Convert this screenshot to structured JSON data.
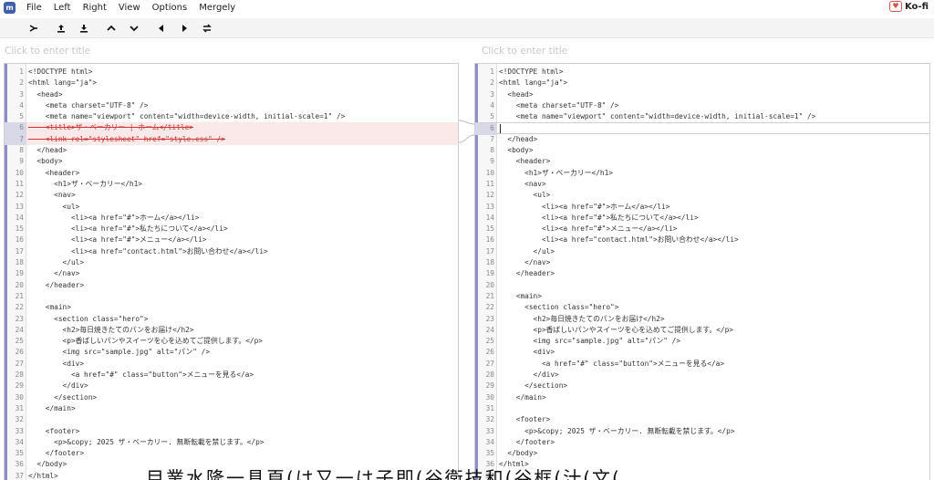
{
  "menubar": {
    "items": [
      "File",
      "Left",
      "Right",
      "View",
      "Options",
      "Mergely"
    ],
    "kofi_label": "Ko-fi"
  },
  "titles": {
    "left_placeholder": "Click to enter title",
    "right_placeholder": "Click to enter title"
  },
  "left_lines": [
    {
      "n": "1",
      "t": "<!DOCTYPE html>"
    },
    {
      "n": "2",
      "t": "<html lang=\"ja\">"
    },
    {
      "n": "3",
      "t": "  <head>"
    },
    {
      "n": "4",
      "t": "    <meta charset=\"UTF-8\" />"
    },
    {
      "n": "5",
      "t": "    <meta name=\"viewport\" content=\"width=device-width, initial-scale=1\" />"
    },
    {
      "n": "6",
      "t": "    <title>ザ・ベーカリー | ホーム</title>",
      "deleted": true
    },
    {
      "n": "7",
      "t": "    <link rel=\"stylesheet\" href=\"style.css\" />",
      "deleted": true
    },
    {
      "n": "8",
      "t": "  </head>"
    },
    {
      "n": "9",
      "t": "  <body>"
    },
    {
      "n": "10",
      "t": "    <header>"
    },
    {
      "n": "11",
      "t": "      <h1>ザ・ベーカリー</h1>"
    },
    {
      "n": "12",
      "t": "      <nav>"
    },
    {
      "n": "13",
      "t": "        <ul>"
    },
    {
      "n": "14",
      "t": "          <li><a href=\"#\">ホーム</a></li>"
    },
    {
      "n": "15",
      "t": "          <li><a href=\"#\">私たちについて</a></li>"
    },
    {
      "n": "16",
      "t": "          <li><a href=\"#\">メニュー</a></li>"
    },
    {
      "n": "17",
      "t": "          <li><a href=\"contact.html\">お問い合わせ</a></li>"
    },
    {
      "n": "18",
      "t": "        </ul>"
    },
    {
      "n": "19",
      "t": "      </nav>"
    },
    {
      "n": "20",
      "t": "    </header>"
    },
    {
      "n": "21",
      "t": ""
    },
    {
      "n": "22",
      "t": "    <main>"
    },
    {
      "n": "23",
      "t": "      <section class=\"hero\">"
    },
    {
      "n": "24",
      "t": "        <h2>毎日焼きたてのパンをお届け</h2>"
    },
    {
      "n": "25",
      "t": "        <p>香ばしいパンやスイーツを心を込めてご提供します。</p>"
    },
    {
      "n": "26",
      "t": "        <img src=\"sample.jpg\" alt=\"パン\" />"
    },
    {
      "n": "27",
      "t": "        <div>"
    },
    {
      "n": "28",
      "t": "          <a href=\"#\" class=\"button\">メニューを見る</a>"
    },
    {
      "n": "29",
      "t": "        </div>"
    },
    {
      "n": "30",
      "t": "      </section>"
    },
    {
      "n": "31",
      "t": "    </main>"
    },
    {
      "n": "32",
      "t": ""
    },
    {
      "n": "33",
      "t": "    <footer>"
    },
    {
      "n": "34",
      "t": "      <p>&copy; 2025 ザ・ベーカリー. 無断転載を禁じます。</p>"
    },
    {
      "n": "35",
      "t": "    </footer>"
    },
    {
      "n": "36",
      "t": "  </body>"
    },
    {
      "n": "37",
      "t": "</html>"
    }
  ],
  "right_lines": [
    {
      "n": "1",
      "t": "<!DOCTYPE html>"
    },
    {
      "n": "2",
      "t": "<html lang=\"ja\">"
    },
    {
      "n": "3",
      "t": "  <head>"
    },
    {
      "n": "4",
      "t": "    <meta charset=\"UTF-8\" />"
    },
    {
      "n": "5",
      "t": "    <meta name=\"viewport\" content=\"width=device-width, initial-scale=1\" />"
    },
    {
      "n": "6",
      "t": "",
      "changed": true
    },
    {
      "n": "7",
      "t": "  </head>"
    },
    {
      "n": "8",
      "t": "  <body>"
    },
    {
      "n": "9",
      "t": "    <header>"
    },
    {
      "n": "10",
      "t": "      <h1>ザ・ベーカリー</h1>"
    },
    {
      "n": "11",
      "t": "      <nav>"
    },
    {
      "n": "12",
      "t": "        <ul>"
    },
    {
      "n": "13",
      "t": "          <li><a href=\"#\">ホーム</a></li>"
    },
    {
      "n": "14",
      "t": "          <li><a href=\"#\">私たちについて</a></li>"
    },
    {
      "n": "15",
      "t": "          <li><a href=\"#\">メニュー</a></li>"
    },
    {
      "n": "16",
      "t": "          <li><a href=\"contact.html\">お問い合わせ</a></li>"
    },
    {
      "n": "17",
      "t": "        </ul>"
    },
    {
      "n": "18",
      "t": "      </nav>"
    },
    {
      "n": "19",
      "t": "    </header>"
    },
    {
      "n": "20",
      "t": ""
    },
    {
      "n": "21",
      "t": "    <main>"
    },
    {
      "n": "22",
      "t": "      <section class=\"hero\">"
    },
    {
      "n": "23",
      "t": "        <h2>毎日焼きたてのパンをお届け</h2>"
    },
    {
      "n": "24",
      "t": "        <p>香ばしいパンやスイーツを心を込めてご提供します。</p>"
    },
    {
      "n": "25",
      "t": "        <img src=\"sample.jpg\" alt=\"パン\" />"
    },
    {
      "n": "26",
      "t": "        <div>"
    },
    {
      "n": "27",
      "t": "          <a href=\"#\" class=\"button\">メニューを見る</a>"
    },
    {
      "n": "28",
      "t": "        </div>"
    },
    {
      "n": "29",
      "t": "      </section>"
    },
    {
      "n": "30",
      "t": "    </main>"
    },
    {
      "n": "31",
      "t": ""
    },
    {
      "n": "32",
      "t": "    <footer>"
    },
    {
      "n": "33",
      "t": "      <p>&copy; 2025 ザ・ベーカリー. 無断転載を禁じます。</p>"
    },
    {
      "n": "34",
      "t": "    </footer>"
    },
    {
      "n": "35",
      "t": "  </body>"
    },
    {
      "n": "36",
      "t": "</html>"
    },
    {
      "n": "37",
      "t": ""
    }
  ],
  "toolbar": {
    "buttons": [
      "merge-right-icon",
      "upload-icon",
      "download-icon",
      "prev-up-icon",
      "next-down-icon",
      "left-icon",
      "right-icon",
      "swap-icon"
    ]
  },
  "footer_caption": "目業水隆一具頁(は又一は子即(谷衛技和(谷框(汁(文(",
  "colors": {
    "accent": "#8c8fc6",
    "deleted_bg": "#fbe8e8",
    "deleted_text": "#cc3333",
    "logo": "#3f5fa8"
  }
}
